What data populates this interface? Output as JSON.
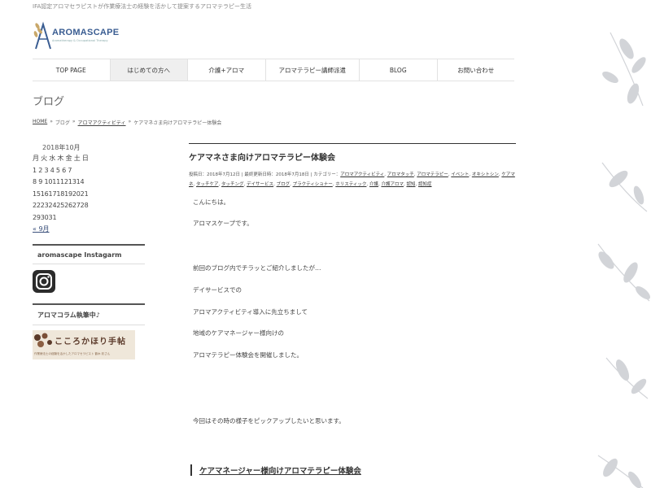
{
  "header": {
    "tagline": "IFA認定アロマセラピストが作業療法士の経験を活かして提案するアロマテラピー生活",
    "logo_text": "AROMASCAPE",
    "logo_sub": "Aromatherapy & Occupational Therapy"
  },
  "nav": {
    "items": [
      {
        "label": "TOP PAGE"
      },
      {
        "label": "はじめての方へ"
      },
      {
        "label": "介護+アロマ"
      },
      {
        "label": "アロマテラピー講師派遣"
      },
      {
        "label": "BLOG"
      },
      {
        "label": "お問い合わせ"
      }
    ]
  },
  "page": {
    "title": "ブログ",
    "breadcrumb": {
      "home": "HOME",
      "sep1": "»",
      "blog": "ブログ",
      "sep2": "»",
      "category": "アロマアクティビティ",
      "sep3": "»",
      "current": "ケアマネさま向けアロマテラピー体験会"
    }
  },
  "sidebar": {
    "calendar": {
      "title": "2018年10月",
      "rows": [
        "月 火 水 木 金 土 日",
        "1 2 3 4 5 6 7",
        "8 9 1011121314",
        "15161718192021",
        "22232425262728",
        "293031"
      ],
      "prev": "« 9月"
    },
    "instagram_heading": "aromascape Instagarm",
    "column_heading": "アロマコラム執筆中♪",
    "banner_text": "こころかほり手帖",
    "banner_sub": "作業療法士の経験を活かしたアロマセラピスト 鶴木 彩さん"
  },
  "post": {
    "title": "ケアマネさま向けアロマテラピー体験会",
    "meta_prefix": "投稿日：2018年7月12日 | 最終更新日時：2018年7月18日 | カテゴリー：",
    "tags": [
      "アロマアクティビティ",
      "アロマタッチ",
      "アロマテラピー",
      "イベント",
      "オキシトシン",
      "ケアマネ",
      "タッチケア",
      "タッチング",
      "デイサービス",
      "ブログ",
      "プラクティショナー",
      "ホリスティック",
      "介護",
      "介護アロマ",
      "認知",
      "認知症"
    ],
    "paragraphs": [
      "こんにちは。",
      "アロマスケープです。",
      "前回のブログ内でチラッとご紹介しましたが…",
      "デイサービスでの",
      "アロマアクティビティ導入に先立ちまして",
      "地域のケアマネージャー様向けの",
      "アロマテラピー体験会を開催しました。",
      "今回はその時の様子をピックアップしたいと思います。"
    ],
    "section_heading": "ケアマネージャー様向けアロマテラピー体験会"
  },
  "colors": {
    "accent": "#3a5d92",
    "leaf": "#c9ccd0",
    "nav_active_bg": "#efefef"
  }
}
